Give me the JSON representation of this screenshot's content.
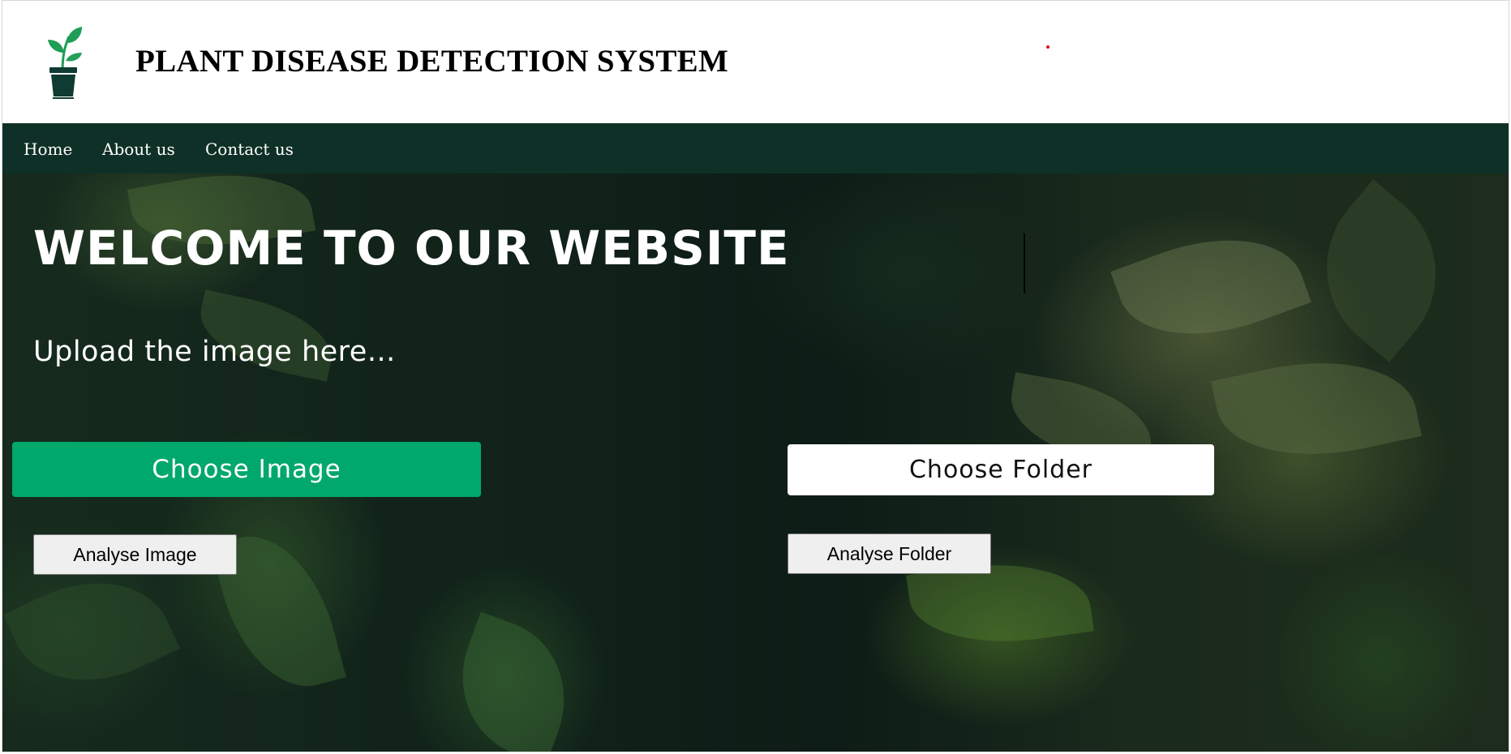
{
  "header": {
    "title": "PLANT DISEASE DETECTION SYSTEM",
    "logo_icon": "potted-plant-icon"
  },
  "nav": {
    "items": [
      {
        "label": "Home"
      },
      {
        "label": "About us"
      },
      {
        "label": "Contact us"
      }
    ]
  },
  "hero": {
    "heading": "WELCOME TO OUR WEBSITE",
    "subheading": "Upload the image here..."
  },
  "actions": {
    "choose_image_label": "Choose Image",
    "choose_folder_label": "Choose Folder",
    "analyse_image_label": "Analyse Image",
    "analyse_folder_label": "Analyse Folder"
  },
  "colors": {
    "navbar": "#0f3026",
    "primary_button": "#00a86b",
    "logo_pot": "#0f3b33",
    "logo_leaf": "#1f9d57"
  }
}
